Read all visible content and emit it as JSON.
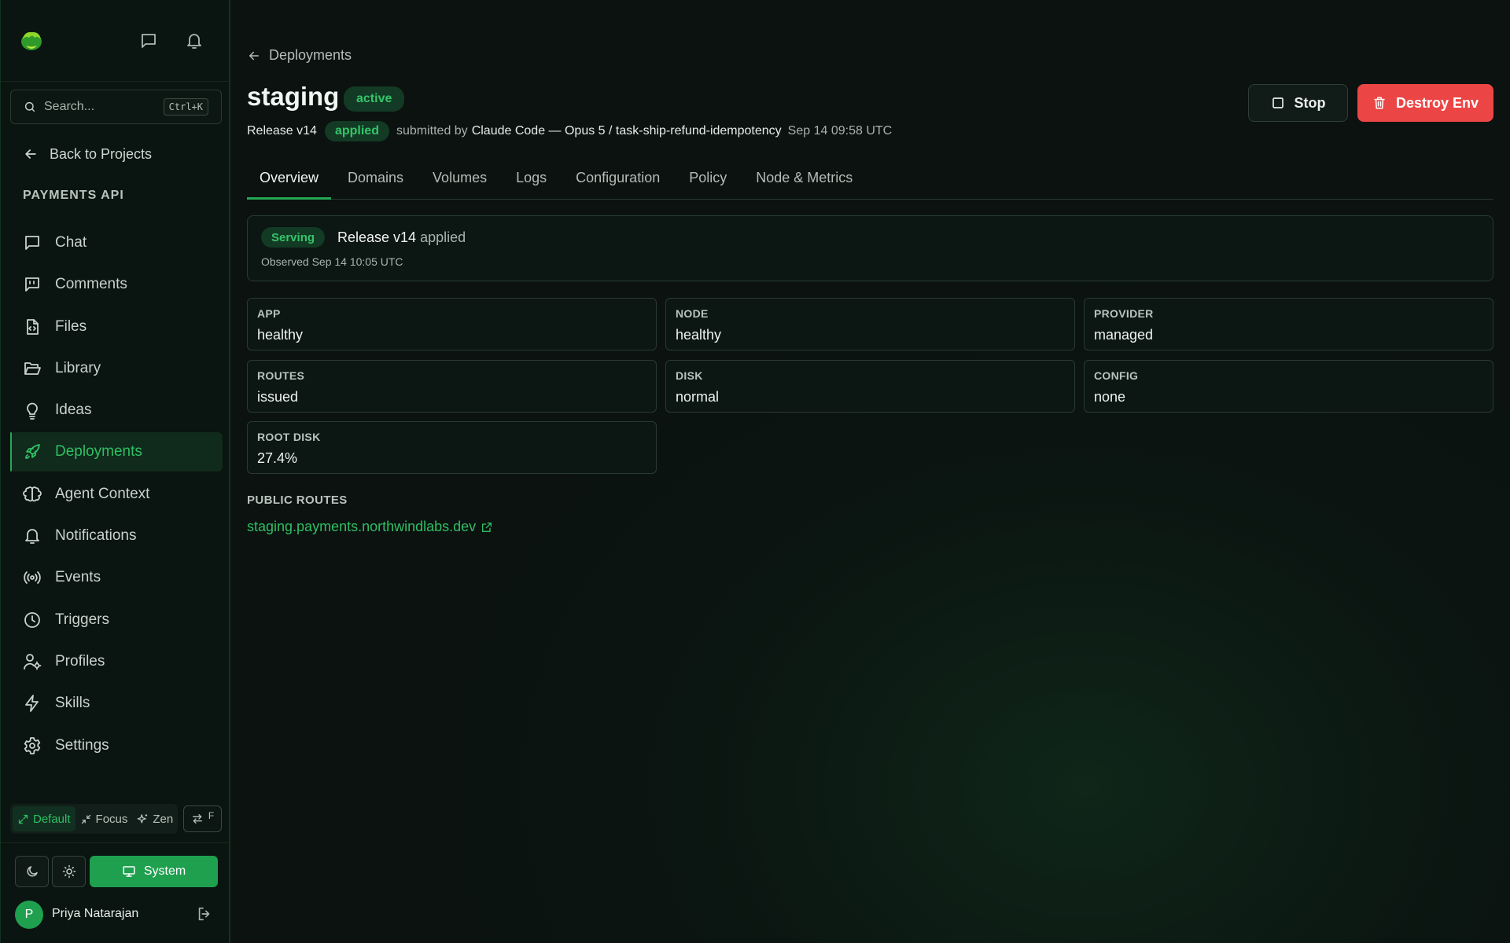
{
  "sidebar": {
    "search_placeholder": "Search...",
    "search_shortcut": "Ctrl+K",
    "back_label": "Back to Projects",
    "project_title": "PAYMENTS API",
    "items": [
      {
        "label": "Chat",
        "icon": "chat-icon"
      },
      {
        "label": "Comments",
        "icon": "comments-icon"
      },
      {
        "label": "Files",
        "icon": "file-code-icon"
      },
      {
        "label": "Library",
        "icon": "folder-open-icon"
      },
      {
        "label": "Ideas",
        "icon": "lightbulb-icon"
      },
      {
        "label": "Deployments",
        "icon": "rocket-icon",
        "active": true
      },
      {
        "label": "Agent Context",
        "icon": "brain-icon"
      },
      {
        "label": "Notifications",
        "icon": "bell-icon"
      },
      {
        "label": "Events",
        "icon": "broadcast-icon"
      },
      {
        "label": "Triggers",
        "icon": "clock-icon"
      },
      {
        "label": "Profiles",
        "icon": "user-cog-icon"
      },
      {
        "label": "Skills",
        "icon": "zap-icon"
      },
      {
        "label": "Settings",
        "icon": "gear-icon"
      }
    ],
    "modes": {
      "default": "Default",
      "focus": "Focus",
      "zen": "Zen",
      "active": "Default"
    },
    "swap_key": "F",
    "theme": {
      "system_label": "System",
      "selected": "System"
    },
    "user": {
      "initial": "P",
      "name": "Priya Natarajan"
    }
  },
  "header": {
    "breadcrumb": "Deployments",
    "env_name": "staging",
    "env_status": "active",
    "release": "Release v14",
    "release_status": "applied",
    "submitted_prefix": "submitted by",
    "submitter": "Claude Code — Opus 5 / task-ship-refund-idempotency",
    "submitted_at": "Sep 14 09:58 UTC",
    "stop_label": "Stop",
    "destroy_label": "Destroy Env"
  },
  "tabs": [
    {
      "label": "Overview",
      "active": true
    },
    {
      "label": "Domains"
    },
    {
      "label": "Volumes"
    },
    {
      "label": "Logs"
    },
    {
      "label": "Configuration"
    },
    {
      "label": "Policy"
    },
    {
      "label": "Node & Metrics"
    }
  ],
  "serving": {
    "badge": "Serving",
    "release": "Release v14",
    "suffix": "applied",
    "observed": "Observed Sep 14 10:05 UTC"
  },
  "stats": [
    {
      "label": "APP",
      "value": "healthy"
    },
    {
      "label": "NODE",
      "value": "healthy"
    },
    {
      "label": "PROVIDER",
      "value": "managed"
    },
    {
      "label": "ROUTES",
      "value": "issued"
    },
    {
      "label": "DISK",
      "value": "normal"
    },
    {
      "label": "CONFIG",
      "value": "none"
    },
    {
      "label": "ROOT DISK",
      "value": "27.4%"
    }
  ],
  "public_routes": {
    "title": "PUBLIC ROUTES",
    "links": [
      "staging.payments.northwindlabs.dev"
    ]
  },
  "colors": {
    "accent": "#25a856",
    "danger": "#ec4545",
    "background": "#0b1511"
  }
}
